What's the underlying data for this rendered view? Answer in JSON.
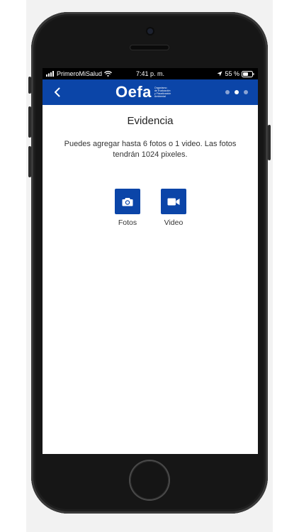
{
  "status": {
    "carrier": "PrimeroMiSalud",
    "time": "7:41 p. m.",
    "battery": "55 %"
  },
  "header": {
    "logo_text": "Oefa",
    "logo_subtitle": [
      "Organismo",
      "de Evaluación",
      "y Fiscalización",
      "Ambiental"
    ],
    "page_count": 3,
    "active_page": 2
  },
  "main": {
    "title": "Evidencia",
    "description": "Puedes agregar hasta 6 fotos o 1 video. Las fotos tendrán 1024 pixeles.",
    "options": [
      {
        "label": "Fotos",
        "icon": "camera-icon"
      },
      {
        "label": "Video",
        "icon": "video-camera-icon"
      }
    ]
  },
  "colors": {
    "brand_blue": "#0b45a8",
    "status_bar": "#000000",
    "background": "#ffffff"
  }
}
